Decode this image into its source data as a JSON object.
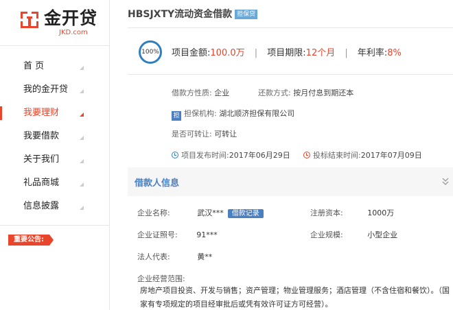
{
  "brand": {
    "name": "金开贷",
    "domain": "JKD.com",
    "colors": {
      "accent": "#e8452c",
      "blue": "#4a7fc1"
    }
  },
  "sidebar": {
    "items": [
      {
        "label": "首 页",
        "active": false
      },
      {
        "label": "我的金开贷",
        "active": false
      },
      {
        "label": "我要理财",
        "active": true
      },
      {
        "label": "我要借款",
        "active": false
      },
      {
        "label": "关于我们",
        "active": false
      },
      {
        "label": "礼品商城",
        "active": false
      },
      {
        "label": "信息披露",
        "active": false
      }
    ],
    "notice_label": "重要公告:"
  },
  "project": {
    "title": "HBSJXTY流动资金借款",
    "tag": "担保贷",
    "progress": "100%",
    "progress_value": 1.0,
    "amount_label": "项目金额:",
    "amount_value": "100.0万",
    "term_label": "项目期限:",
    "term_value": "12个月",
    "rate_label": "年利率:",
    "rate_value": "8%",
    "borrow_nature_label": "借款方性质:",
    "borrow_nature_value": "企业",
    "repay_label": "还款方式:",
    "repay_value": "按月付息到期还本",
    "guarantee_icon": "担",
    "guarantee_label": "担保机构:",
    "guarantee_value": "湖北顺济担保有限公司",
    "transfer_label": "是否可转让:",
    "transfer_value": "可转让",
    "publish_label": "项目发布时间:",
    "publish_value": "2017年06月29日",
    "end_label": "投标结束时间:",
    "end_value": "2017年07月09日"
  },
  "borrower": {
    "section_title": "借款人信息",
    "company_name_label": "企业名称:",
    "company_name_value": "武汉***",
    "record_tag": "借款记录",
    "capital_label": "注册资本:",
    "capital_value": "1000万",
    "license_label": "企业证照号:",
    "license_value": "91***",
    "scale_label": "企业规模:",
    "scale_value": "小型企业",
    "legal_label": "法人代表:",
    "legal_value": "黄**",
    "scope_label": "企业经营范围:",
    "scope_value": "房地产项目投资、开发与销售；资产管理；物业管理服务；酒店管理（不含住宿和餐饮）。（国家有专项规定的项目经审批后或凭有效许可证方可经营）。"
  }
}
